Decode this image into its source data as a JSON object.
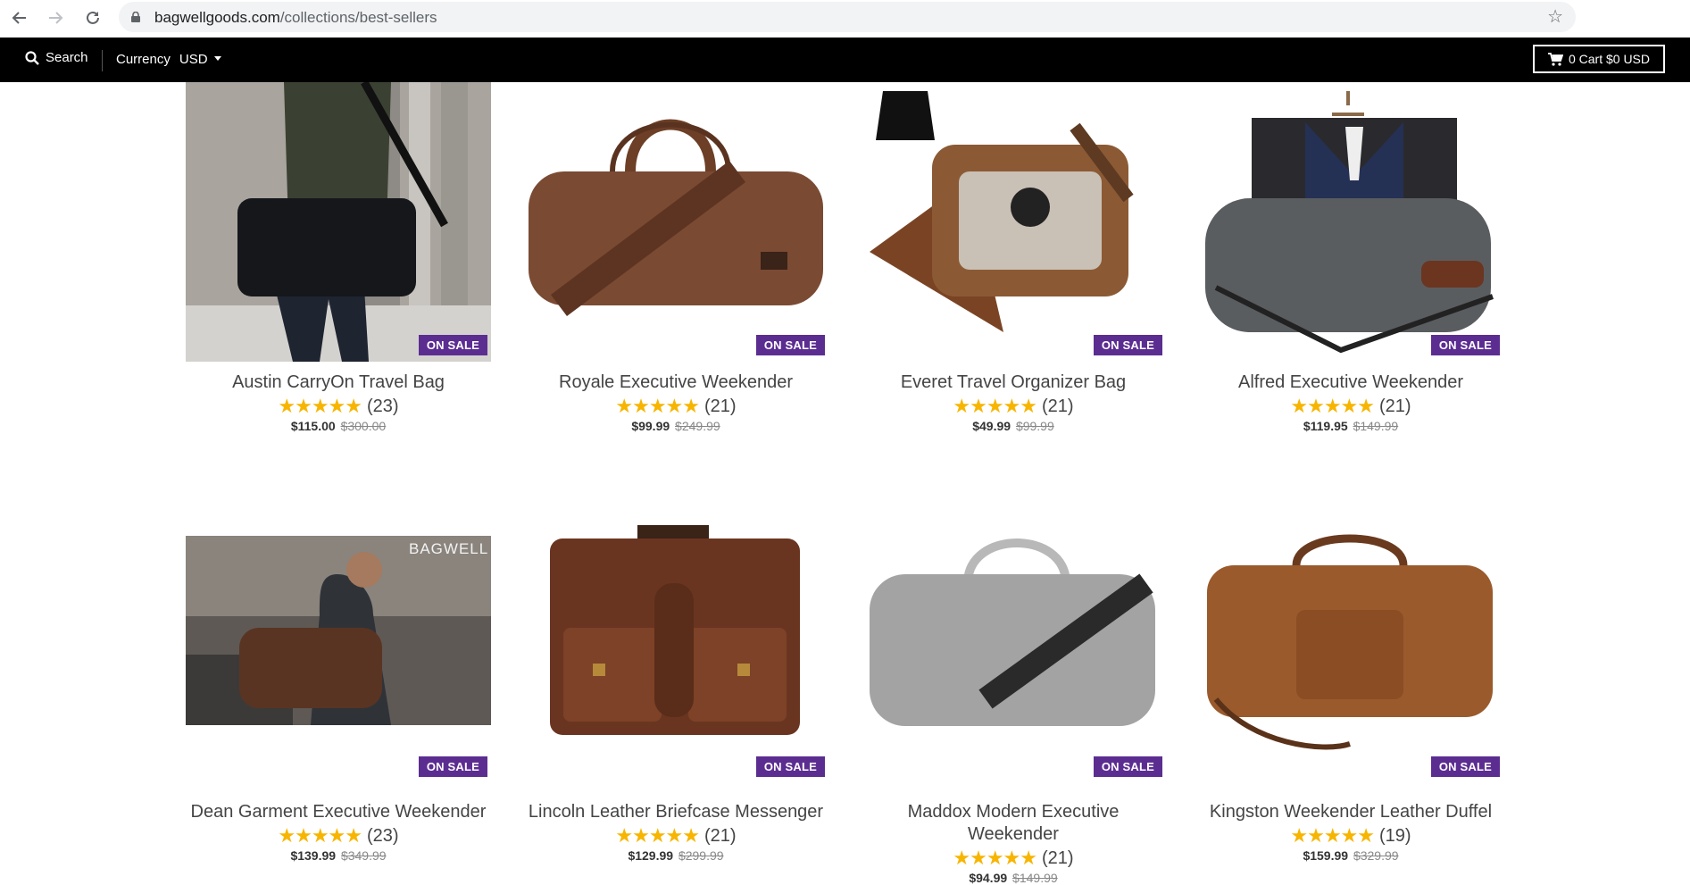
{
  "browser": {
    "url_host": "bagwellgoods.com",
    "url_path": "/collections/best-sellers"
  },
  "store_header": {
    "search_label": "Search",
    "currency_label": "Currency",
    "currency_value": "USD",
    "cart_label": "0 Cart $0 USD"
  },
  "badge_label": "ON SALE",
  "products": [
    {
      "title": "Austin CarryOn Travel Bag",
      "reviews": "(23)",
      "price": "$115.00",
      "compare_price": "$300.00",
      "rating": 5
    },
    {
      "title": "Royale Executive Weekender",
      "reviews": "(21)",
      "price": "$99.99",
      "compare_price": "$249.99",
      "rating": 5
    },
    {
      "title": "Everet Travel Organizer Bag",
      "reviews": "(21)",
      "price": "$49.99",
      "compare_price": "$99.99",
      "rating": 5
    },
    {
      "title": "Alfred Executive Weekender",
      "reviews": "(21)",
      "price": "$119.95",
      "compare_price": "$149.99",
      "rating": 5
    },
    {
      "title": "Dean Garment Executive Weekender",
      "reviews": "(23)",
      "price": "$139.99",
      "compare_price": "$349.99",
      "rating": 5,
      "image_caption": "BAGWELL"
    },
    {
      "title": "Lincoln Leather Briefcase Messenger",
      "reviews": "(21)",
      "price": "$129.99",
      "compare_price": "$299.99",
      "rating": 5
    },
    {
      "title": "Maddox Modern Executive Weekender",
      "reviews": "(21)",
      "price": "$94.99",
      "compare_price": "$149.99",
      "rating": 5
    },
    {
      "title": "Kingston Weekender Leather Duffel",
      "reviews": "(19)",
      "price": "$159.99",
      "compare_price": "$329.99",
      "rating": 5
    }
  ],
  "colors": {
    "badge": "#5c2d91",
    "star": "#f7b500",
    "header_bg": "#000000"
  }
}
